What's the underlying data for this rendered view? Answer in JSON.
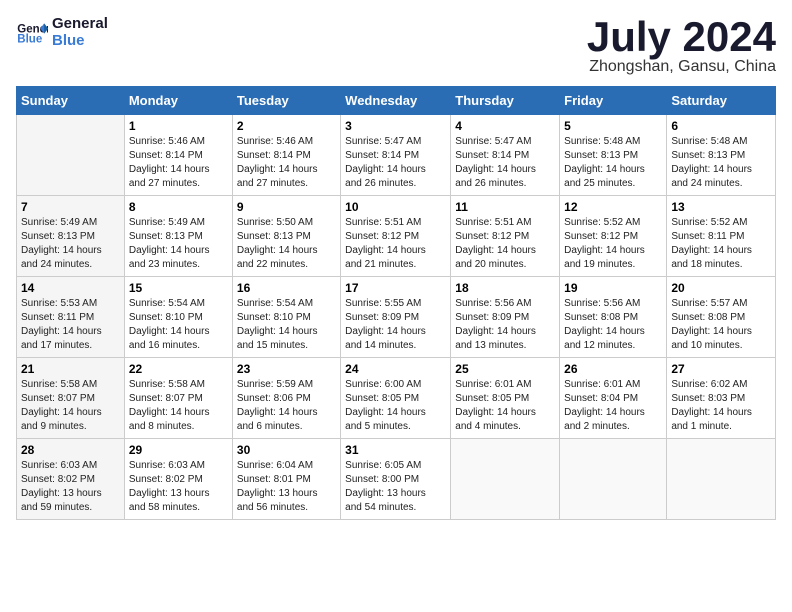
{
  "logo": {
    "line1": "General",
    "line2": "Blue"
  },
  "title": "July 2024",
  "subtitle": "Zhongshan, Gansu, China",
  "days_header": [
    "Sunday",
    "Monday",
    "Tuesday",
    "Wednesday",
    "Thursday",
    "Friday",
    "Saturday"
  ],
  "weeks": [
    [
      {
        "day": "",
        "info": ""
      },
      {
        "day": "1",
        "info": "Sunrise: 5:46 AM\nSunset: 8:14 PM\nDaylight: 14 hours\nand 27 minutes."
      },
      {
        "day": "2",
        "info": "Sunrise: 5:46 AM\nSunset: 8:14 PM\nDaylight: 14 hours\nand 27 minutes."
      },
      {
        "day": "3",
        "info": "Sunrise: 5:47 AM\nSunset: 8:14 PM\nDaylight: 14 hours\nand 26 minutes."
      },
      {
        "day": "4",
        "info": "Sunrise: 5:47 AM\nSunset: 8:14 PM\nDaylight: 14 hours\nand 26 minutes."
      },
      {
        "day": "5",
        "info": "Sunrise: 5:48 AM\nSunset: 8:13 PM\nDaylight: 14 hours\nand 25 minutes."
      },
      {
        "day": "6",
        "info": "Sunrise: 5:48 AM\nSunset: 8:13 PM\nDaylight: 14 hours\nand 24 minutes."
      }
    ],
    [
      {
        "day": "7",
        "info": "Sunrise: 5:49 AM\nSunset: 8:13 PM\nDaylight: 14 hours\nand 24 minutes."
      },
      {
        "day": "8",
        "info": "Sunrise: 5:49 AM\nSunset: 8:13 PM\nDaylight: 14 hours\nand 23 minutes."
      },
      {
        "day": "9",
        "info": "Sunrise: 5:50 AM\nSunset: 8:13 PM\nDaylight: 14 hours\nand 22 minutes."
      },
      {
        "day": "10",
        "info": "Sunrise: 5:51 AM\nSunset: 8:12 PM\nDaylight: 14 hours\nand 21 minutes."
      },
      {
        "day": "11",
        "info": "Sunrise: 5:51 AM\nSunset: 8:12 PM\nDaylight: 14 hours\nand 20 minutes."
      },
      {
        "day": "12",
        "info": "Sunrise: 5:52 AM\nSunset: 8:12 PM\nDaylight: 14 hours\nand 19 minutes."
      },
      {
        "day": "13",
        "info": "Sunrise: 5:52 AM\nSunset: 8:11 PM\nDaylight: 14 hours\nand 18 minutes."
      }
    ],
    [
      {
        "day": "14",
        "info": "Sunrise: 5:53 AM\nSunset: 8:11 PM\nDaylight: 14 hours\nand 17 minutes."
      },
      {
        "day": "15",
        "info": "Sunrise: 5:54 AM\nSunset: 8:10 PM\nDaylight: 14 hours\nand 16 minutes."
      },
      {
        "day": "16",
        "info": "Sunrise: 5:54 AM\nSunset: 8:10 PM\nDaylight: 14 hours\nand 15 minutes."
      },
      {
        "day": "17",
        "info": "Sunrise: 5:55 AM\nSunset: 8:09 PM\nDaylight: 14 hours\nand 14 minutes."
      },
      {
        "day": "18",
        "info": "Sunrise: 5:56 AM\nSunset: 8:09 PM\nDaylight: 14 hours\nand 13 minutes."
      },
      {
        "day": "19",
        "info": "Sunrise: 5:56 AM\nSunset: 8:08 PM\nDaylight: 14 hours\nand 12 minutes."
      },
      {
        "day": "20",
        "info": "Sunrise: 5:57 AM\nSunset: 8:08 PM\nDaylight: 14 hours\nand 10 minutes."
      }
    ],
    [
      {
        "day": "21",
        "info": "Sunrise: 5:58 AM\nSunset: 8:07 PM\nDaylight: 14 hours\nand 9 minutes."
      },
      {
        "day": "22",
        "info": "Sunrise: 5:58 AM\nSunset: 8:07 PM\nDaylight: 14 hours\nand 8 minutes."
      },
      {
        "day": "23",
        "info": "Sunrise: 5:59 AM\nSunset: 8:06 PM\nDaylight: 14 hours\nand 6 minutes."
      },
      {
        "day": "24",
        "info": "Sunrise: 6:00 AM\nSunset: 8:05 PM\nDaylight: 14 hours\nand 5 minutes."
      },
      {
        "day": "25",
        "info": "Sunrise: 6:01 AM\nSunset: 8:05 PM\nDaylight: 14 hours\nand 4 minutes."
      },
      {
        "day": "26",
        "info": "Sunrise: 6:01 AM\nSunset: 8:04 PM\nDaylight: 14 hours\nand 2 minutes."
      },
      {
        "day": "27",
        "info": "Sunrise: 6:02 AM\nSunset: 8:03 PM\nDaylight: 14 hours\nand 1 minute."
      }
    ],
    [
      {
        "day": "28",
        "info": "Sunrise: 6:03 AM\nSunset: 8:02 PM\nDaylight: 13 hours\nand 59 minutes."
      },
      {
        "day": "29",
        "info": "Sunrise: 6:03 AM\nSunset: 8:02 PM\nDaylight: 13 hours\nand 58 minutes."
      },
      {
        "day": "30",
        "info": "Sunrise: 6:04 AM\nSunset: 8:01 PM\nDaylight: 13 hours\nand 56 minutes."
      },
      {
        "day": "31",
        "info": "Sunrise: 6:05 AM\nSunset: 8:00 PM\nDaylight: 13 hours\nand 54 minutes."
      },
      {
        "day": "",
        "info": ""
      },
      {
        "day": "",
        "info": ""
      },
      {
        "day": "",
        "info": ""
      }
    ]
  ]
}
